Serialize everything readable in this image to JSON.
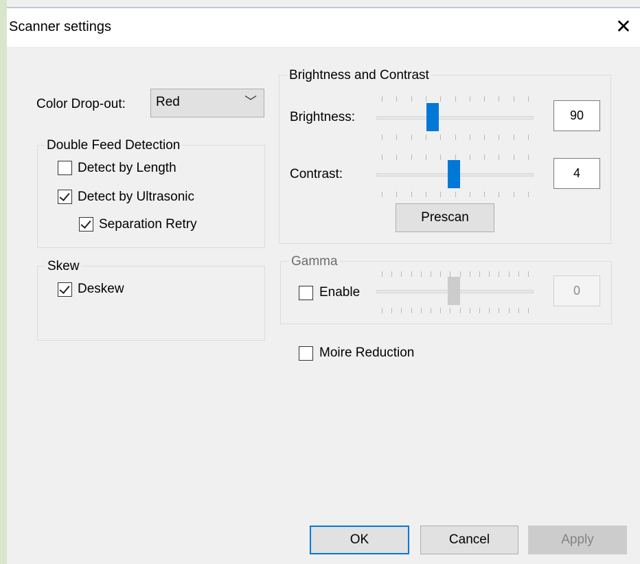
{
  "window": {
    "title": "Scanner settings",
    "close_glyph": "✕"
  },
  "color_dropout": {
    "label": "Color Drop-out:",
    "selected": "Red",
    "chevron": "﹀"
  },
  "double_feed": {
    "legend": "Double Feed Detection",
    "detect_by_length": {
      "label": "Detect by Length",
      "checked": false
    },
    "detect_by_ultrasonic": {
      "label": "Detect by Ultrasonic",
      "checked": true
    },
    "separation_retry": {
      "label": "Separation Retry",
      "checked": true
    }
  },
  "skew": {
    "legend": "Skew",
    "deskew": {
      "label": "Deskew",
      "checked": true
    }
  },
  "brightness_contrast": {
    "legend": "Brightness and Contrast",
    "brightness": {
      "label": "Brightness:",
      "value": "90"
    },
    "contrast": {
      "label": "Contrast:",
      "value": "4"
    },
    "prescan_label": "Prescan"
  },
  "gamma": {
    "legend": "Gamma",
    "enable": {
      "label": "Enable",
      "checked": false
    },
    "value": "0"
  },
  "moire": {
    "label": "Moire Reduction",
    "checked": false
  },
  "buttons": {
    "ok": "OK",
    "cancel": "Cancel",
    "apply": "Apply"
  },
  "colors": {
    "accent": "#0078d7",
    "background": "#f0f0f0",
    "disabled": "#cccccc"
  }
}
